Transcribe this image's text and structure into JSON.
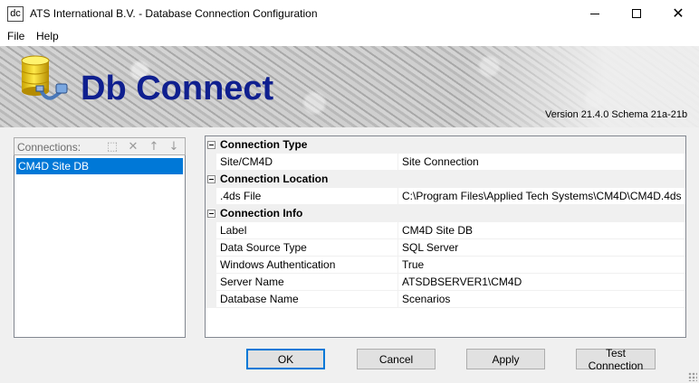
{
  "window": {
    "icon_text": "dc",
    "title": "ATS International B.V. - Database Connection Configuration"
  },
  "menu": {
    "items": [
      {
        "label": "File"
      },
      {
        "label": "Help"
      }
    ]
  },
  "banner": {
    "title": "Db Connect",
    "version": "Version 21.4.0  Schema 21a-21b"
  },
  "connections": {
    "label": "Connections:",
    "items": [
      {
        "label": "CM4D Site DB",
        "selected": true
      }
    ]
  },
  "properties": {
    "categories": [
      {
        "name": "Connection Type",
        "props": [
          {
            "name": "Site/CM4D",
            "value": "Site Connection"
          }
        ]
      },
      {
        "name": "Connection Location",
        "props": [
          {
            "name": ".4ds File",
            "value": "C:\\Program Files\\Applied Tech Systems\\CM4D\\CM4D.4ds"
          }
        ]
      },
      {
        "name": "Connection Info",
        "props": [
          {
            "name": "Label",
            "value": "CM4D Site DB"
          },
          {
            "name": "Data Source Type",
            "value": "SQL Server"
          },
          {
            "name": "Windows Authentication",
            "value": "True"
          },
          {
            "name": "Server Name",
            "value": "ATSDBSERVER1\\CM4D"
          },
          {
            "name": "Database Name",
            "value": "Scenarios"
          }
        ]
      }
    ]
  },
  "buttons": {
    "ok": "OK",
    "cancel": "Cancel",
    "apply": "Apply",
    "test": "Test Connection"
  },
  "colors": {
    "accent": "#0078d7",
    "banner_title": "#0f1f8f"
  }
}
